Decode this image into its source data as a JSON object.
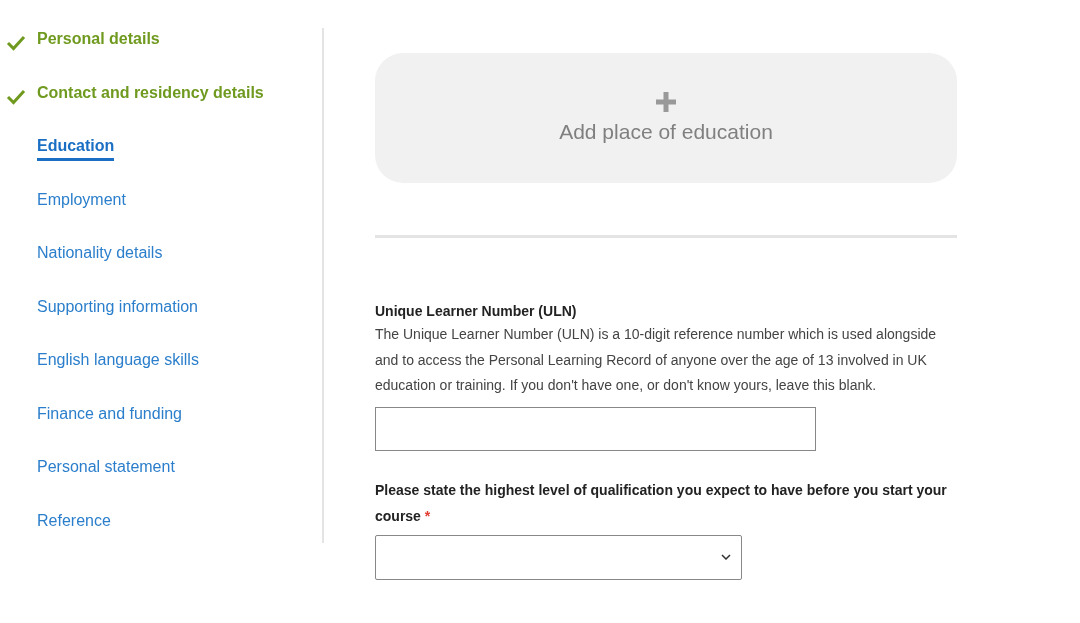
{
  "sidebar": {
    "items": [
      {
        "label": "Personal details",
        "completed": true,
        "selected": false
      },
      {
        "label": "Contact and residency details",
        "completed": true,
        "selected": false
      },
      {
        "label": "Education",
        "completed": false,
        "selected": true
      },
      {
        "label": "Employment",
        "completed": false,
        "selected": false
      },
      {
        "label": "Nationality details",
        "completed": false,
        "selected": false
      },
      {
        "label": "Supporting information",
        "completed": false,
        "selected": false
      },
      {
        "label": "English language skills",
        "completed": false,
        "selected": false
      },
      {
        "label": "Finance and funding",
        "completed": false,
        "selected": false
      },
      {
        "label": "Personal statement",
        "completed": false,
        "selected": false
      },
      {
        "label": "Reference",
        "completed": false,
        "selected": false
      }
    ]
  },
  "add_button": {
    "label": "Add place of education"
  },
  "uln": {
    "label": "Unique Learner Number (ULN)",
    "help": "The Unique Learner Number (ULN) is a 10-digit reference number which is used alongside and to access the Personal Learning Record of anyone over the age of 13 involved in UK education or training. If you don't have one, or don't know yours, leave this blank."
  },
  "qualification": {
    "label": "Please state the highest level of qualification you expect to have before you start your course",
    "required_mark": "*"
  }
}
